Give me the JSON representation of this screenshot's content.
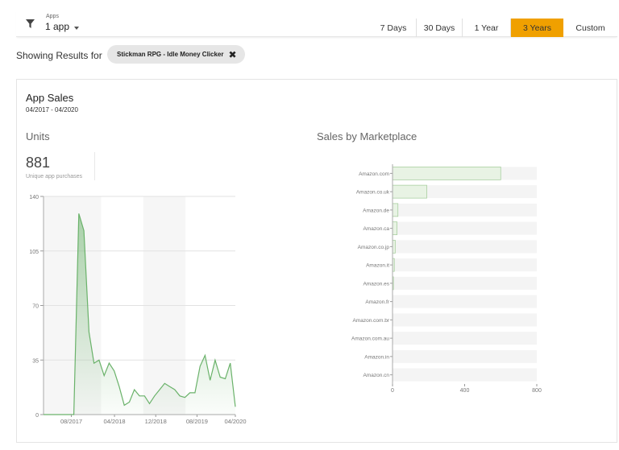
{
  "filter": {
    "icon": "filter-icon",
    "caption": "Apps",
    "value": "1 app"
  },
  "ranges": [
    {
      "label": "7 Days",
      "active": false
    },
    {
      "label": "30 Days",
      "active": false
    },
    {
      "label": "1 Year",
      "active": false
    },
    {
      "label": "3 Years",
      "active": true
    },
    {
      "label": "Custom",
      "active": false
    }
  ],
  "results": {
    "label": "Showing Results for",
    "chip": "Stickman RPG - Idle Money Clicker",
    "chip_close_icon": "close-icon"
  },
  "card": {
    "title": "App Sales",
    "date_range": "04/2017 - 04/2020",
    "units_title": "Units",
    "units_value": "881",
    "units_caption": "Unique app purchases",
    "marketplace_title": "Sales by Marketplace"
  },
  "colors": {
    "accent": "#f0a000",
    "line": "#6ab26a",
    "bar_fill": "#e8f3e4",
    "bar_track": "#f4f4f4"
  },
  "chart_data": [
    {
      "type": "area",
      "title": "Units",
      "ylim": [
        0,
        140
      ],
      "yticks": [
        0,
        35,
        70,
        105,
        140
      ],
      "xtick_labels": [
        "08/2017",
        "04/2018",
        "12/2018",
        "08/2019",
        "04/2020"
      ],
      "grid": true,
      "x": [
        "04/2017",
        "05/2017",
        "06/2017",
        "07/2017",
        "08/2017",
        "09/2017",
        "10/2017",
        "11/2017",
        "12/2017",
        "01/2018",
        "02/2018",
        "03/2018",
        "04/2018",
        "05/2018",
        "06/2018",
        "07/2018",
        "08/2018",
        "09/2018",
        "10/2018",
        "11/2018",
        "12/2018",
        "01/2019",
        "02/2019",
        "03/2019",
        "04/2019",
        "05/2019",
        "06/2019",
        "07/2019",
        "08/2019",
        "09/2019",
        "10/2019",
        "11/2019",
        "12/2019",
        "01/2020",
        "02/2020",
        "03/2020",
        "04/2020"
      ],
      "values": [
        0,
        0,
        0,
        0,
        0,
        0,
        0,
        129,
        118,
        53,
        33,
        35,
        25,
        33,
        28,
        18,
        6,
        8,
        16,
        12,
        12,
        7,
        12,
        16,
        20,
        18,
        16,
        12,
        11,
        14,
        14,
        31,
        38,
        22,
        35,
        24,
        23,
        33,
        5
      ]
    },
    {
      "type": "bar",
      "orientation": "horizontal",
      "title": "Sales by Marketplace",
      "categories": [
        "Amazon.com",
        "Amazon.co.uk",
        "Amazon.de",
        "Amazon.ca",
        "Amazon.co.jp",
        "Amazon.it",
        "Amazon.es",
        "Amazon.fr",
        "Amazon.com.br",
        "Amazon.com.au",
        "Amazon.in",
        "Amazon.cn"
      ],
      "values": [
        600,
        190,
        30,
        25,
        15,
        10,
        5,
        0,
        0,
        0,
        0,
        0
      ],
      "xlim": [
        0,
        800
      ],
      "xticks": [
        0,
        400,
        800
      ]
    }
  ]
}
